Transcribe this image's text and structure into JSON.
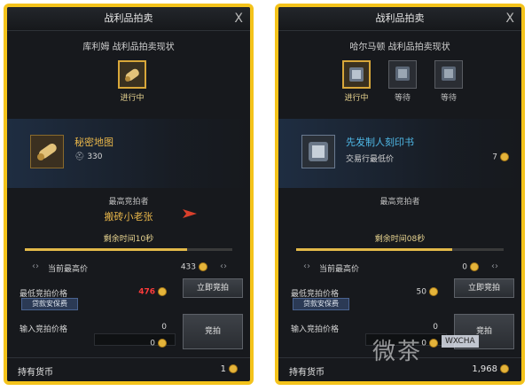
{
  "left": {
    "title": "战利品拍卖",
    "close": "X",
    "subtitle": "库利姆 战利品拍卖现状",
    "queue_status": "进行中",
    "item_name": "秘密地图",
    "item_level": "330",
    "top_bidder_label": "最高竞拍者",
    "top_bidder": "搬砖小老张",
    "timer": "剩余时间10秒",
    "timer_progress": 0.78,
    "current_bid_label": "当前最高价",
    "current_bid": "433",
    "min_bid_label": "最低竞拍价格",
    "min_bid": "476",
    "buy_now": "立即竞拍",
    "payment_protect": "贷款安保费",
    "input_label": "输入竞拍价格",
    "input_value": "0",
    "input_value2": "0",
    "bid_button": "竞拍",
    "currency_label": "持有货币",
    "currency_value": "1"
  },
  "right": {
    "title": "战利品拍卖",
    "close": "X",
    "subtitle": "哈尔马顿 战利品拍卖现状",
    "queue": [
      {
        "label": "进行中",
        "active": true
      },
      {
        "label": "等待",
        "active": false
      },
      {
        "label": "等待",
        "active": false
      }
    ],
    "item_name": "先发制人刻印书",
    "market_label": "交易行最低价",
    "market_value": "7",
    "top_bidder_label": "最高竞拍者",
    "timer": "剩余时间08秒",
    "timer_progress": 0.75,
    "current_bid_label": "当前最高价",
    "current_bid": "0",
    "min_bid_label": "最低竞拍价格",
    "min_bid": "50",
    "buy_now": "立即竞拍",
    "payment_protect": "贷款安保费",
    "input_label": "输入竞拍价格",
    "input_value": "0",
    "input_value2": "0",
    "bid_button": "竞拍",
    "currency_label": "持有货币",
    "currency_value": "1,968"
  },
  "watermark": {
    "text": "微茶",
    "tag": "WXCHA"
  },
  "colors": {
    "border": "#f4c31b",
    "gold_text": "#e8b64a",
    "cyan_text": "#4fb8e6",
    "red_value": "#ff3b3b"
  }
}
